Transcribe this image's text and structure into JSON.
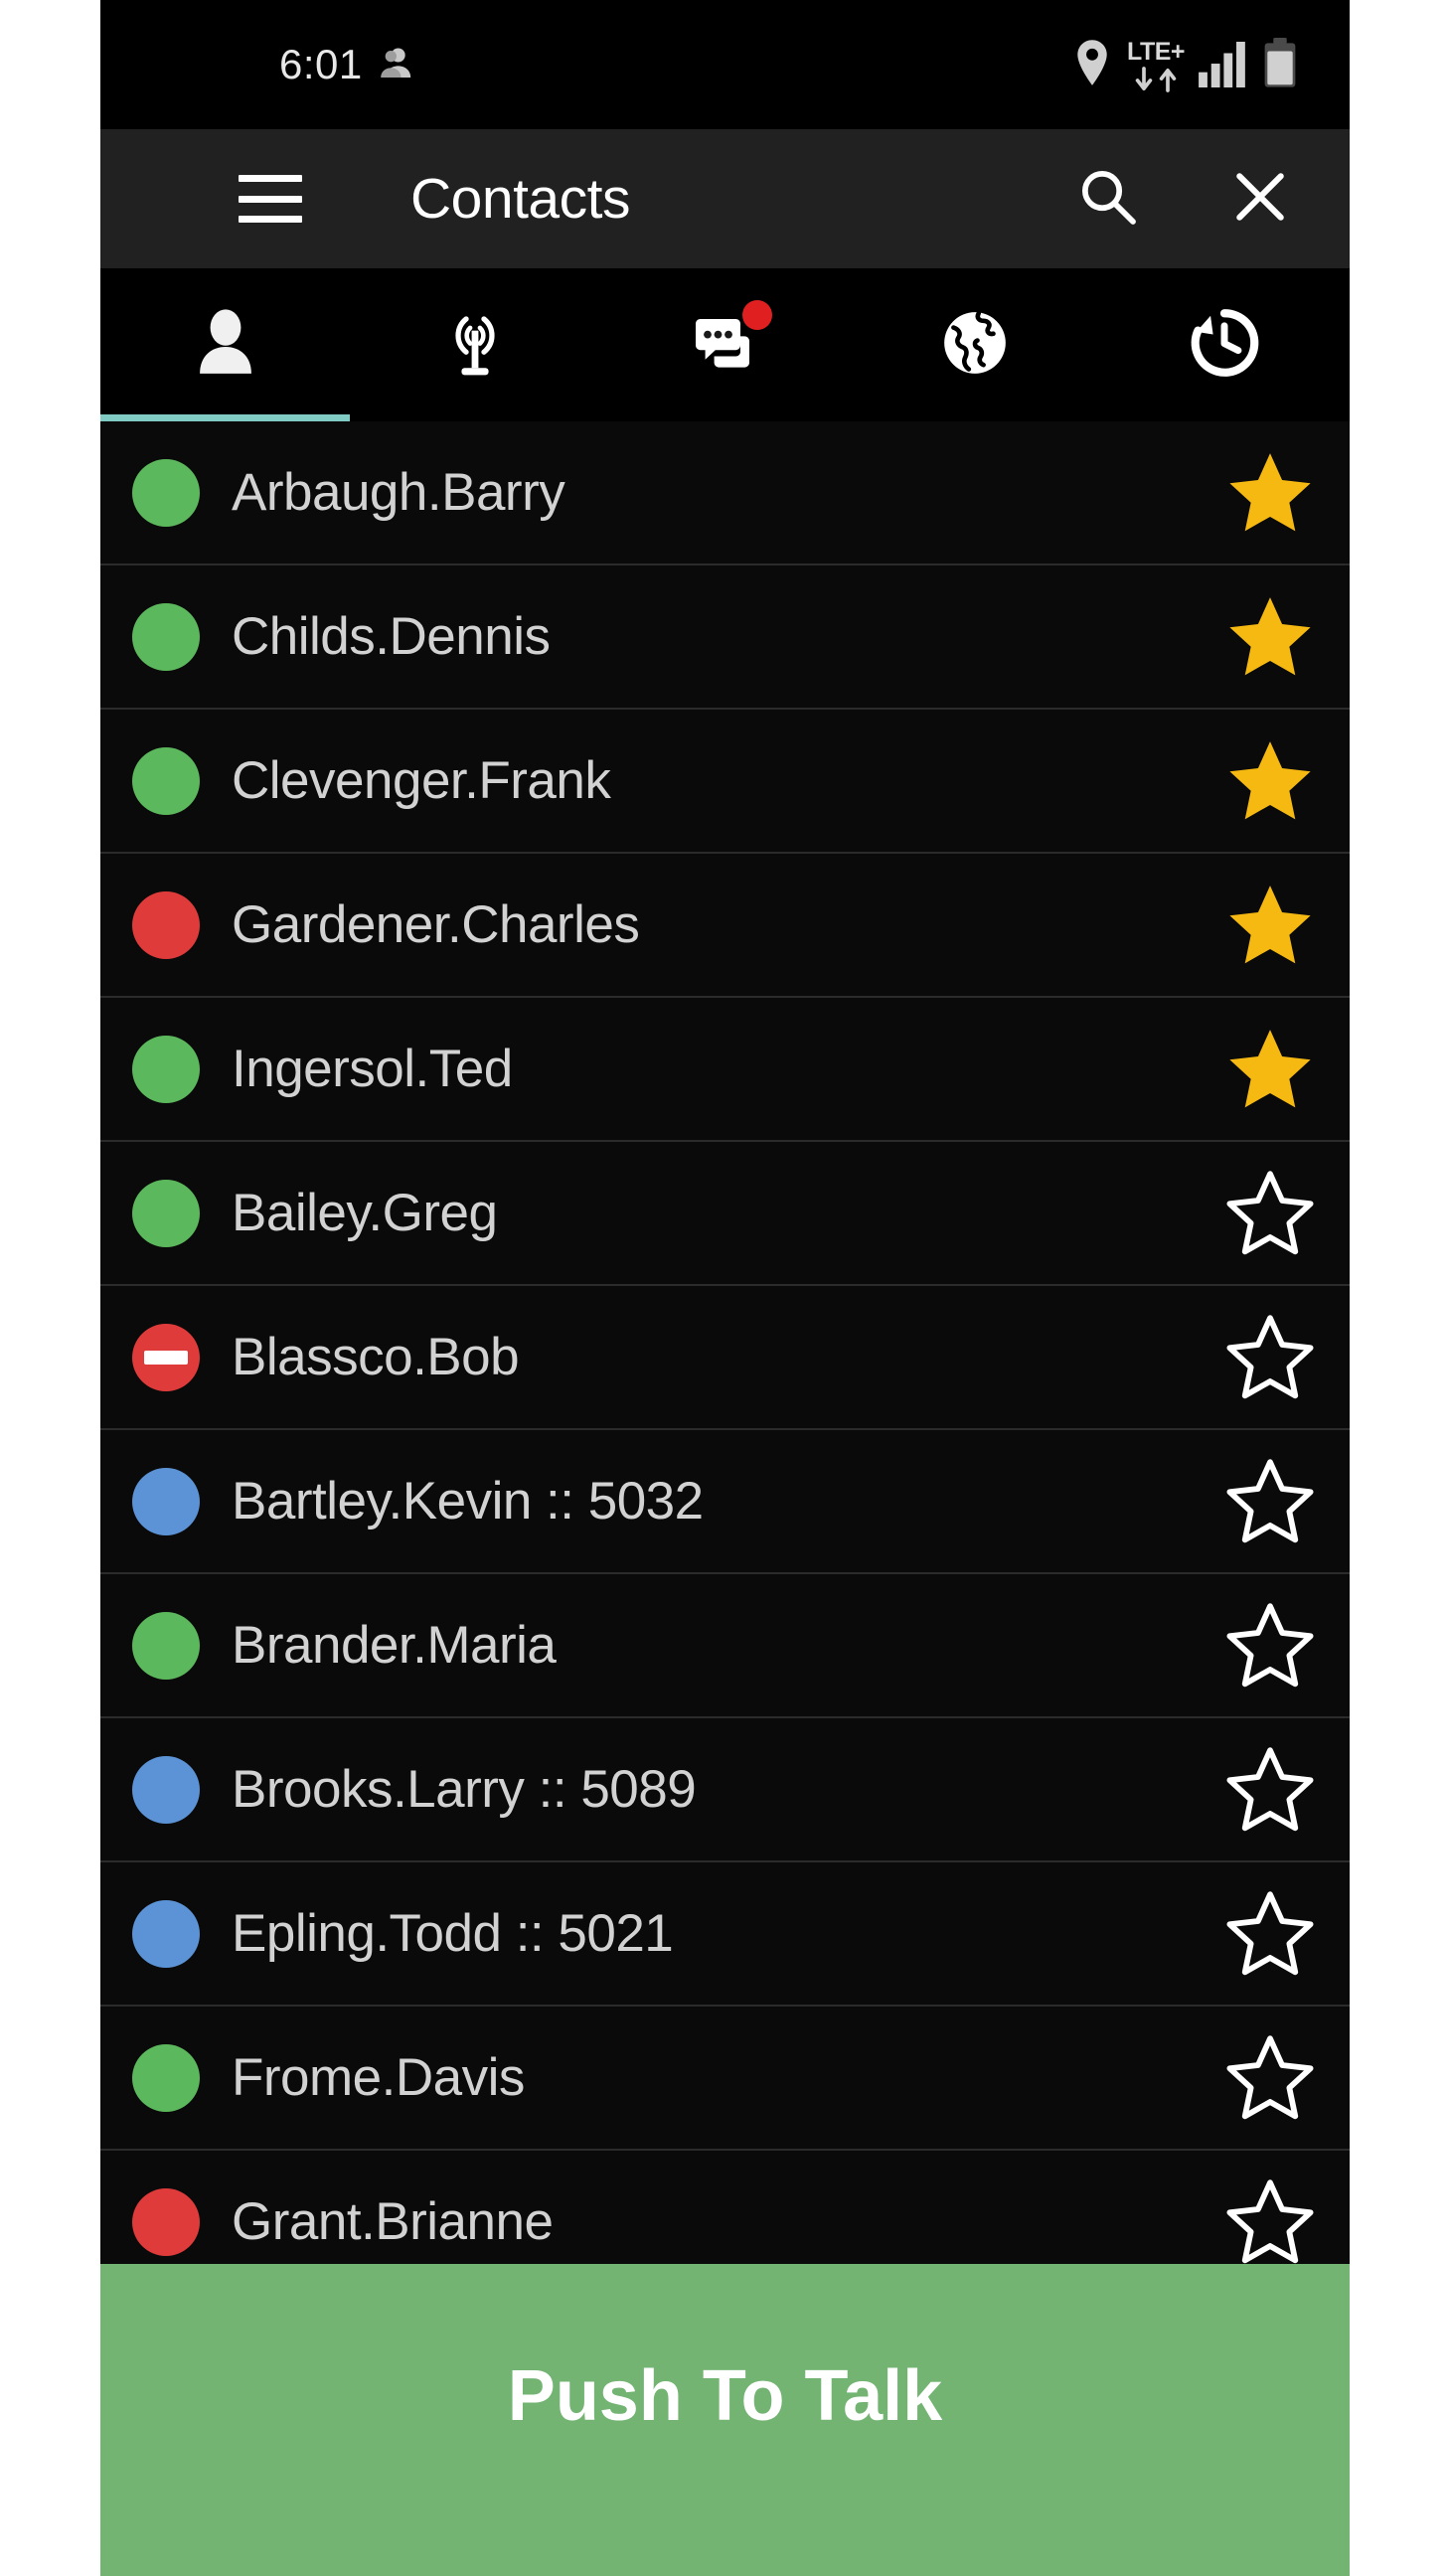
{
  "status_bar": {
    "clock": "6:01",
    "person_icon": "person-icon",
    "location_icon": "location-pin-icon",
    "network_label": "LTE+",
    "data_arrows_icon": "data-transfer-arrows-icon",
    "signal_icon": "signal-bars-icon",
    "battery_icon": "battery-icon"
  },
  "toolbar": {
    "menu_icon": "hamburger-menu-icon",
    "title": "Contacts",
    "search_icon": "search-icon",
    "close_icon": "close-icon"
  },
  "tabs": [
    {
      "name": "contacts",
      "icon": "person-icon",
      "active": true,
      "badge": false
    },
    {
      "name": "broadcast",
      "icon": "antenna-broadcast-icon",
      "active": false,
      "badge": false
    },
    {
      "name": "messages",
      "icon": "chat-bubbles-icon",
      "active": false,
      "badge": true
    },
    {
      "name": "map",
      "icon": "globe-icon",
      "active": false,
      "badge": false
    },
    {
      "name": "history",
      "icon": "history-clock-icon",
      "active": false,
      "badge": false
    }
  ],
  "status_colors": {
    "available": "#5cb85c",
    "busy": "#e03b3b",
    "dnd": "#e03b3b",
    "offline": "#5b93d6",
    "star_on": "#f5b911",
    "star_off": "#ffffff",
    "accent": "#80cbc4",
    "ptt_green": "#73b473"
  },
  "contacts": [
    {
      "name": "Arbaugh.Barry",
      "status": "available",
      "favorite": true
    },
    {
      "name": "Childs.Dennis",
      "status": "available",
      "favorite": true
    },
    {
      "name": "Clevenger.Frank",
      "status": "available",
      "favorite": true
    },
    {
      "name": "Gardener.Charles",
      "status": "busy",
      "favorite": true
    },
    {
      "name": "Ingersol.Ted",
      "status": "available",
      "favorite": true
    },
    {
      "name": "Bailey.Greg",
      "status": "available",
      "favorite": false
    },
    {
      "name": "Blassco.Bob",
      "status": "dnd",
      "favorite": false
    },
    {
      "name": "Bartley.Kevin :: 5032",
      "status": "offline",
      "favorite": false
    },
    {
      "name": "Brander.Maria",
      "status": "available",
      "favorite": false
    },
    {
      "name": "Brooks.Larry :: 5089",
      "status": "offline",
      "favorite": false
    },
    {
      "name": "Epling.Todd :: 5021",
      "status": "offline",
      "favorite": false
    },
    {
      "name": "Frome.Davis",
      "status": "available",
      "favorite": false
    },
    {
      "name": "Grant.Brianne",
      "status": "busy",
      "favorite": false
    }
  ],
  "ptt": {
    "label": "Push To Talk"
  }
}
